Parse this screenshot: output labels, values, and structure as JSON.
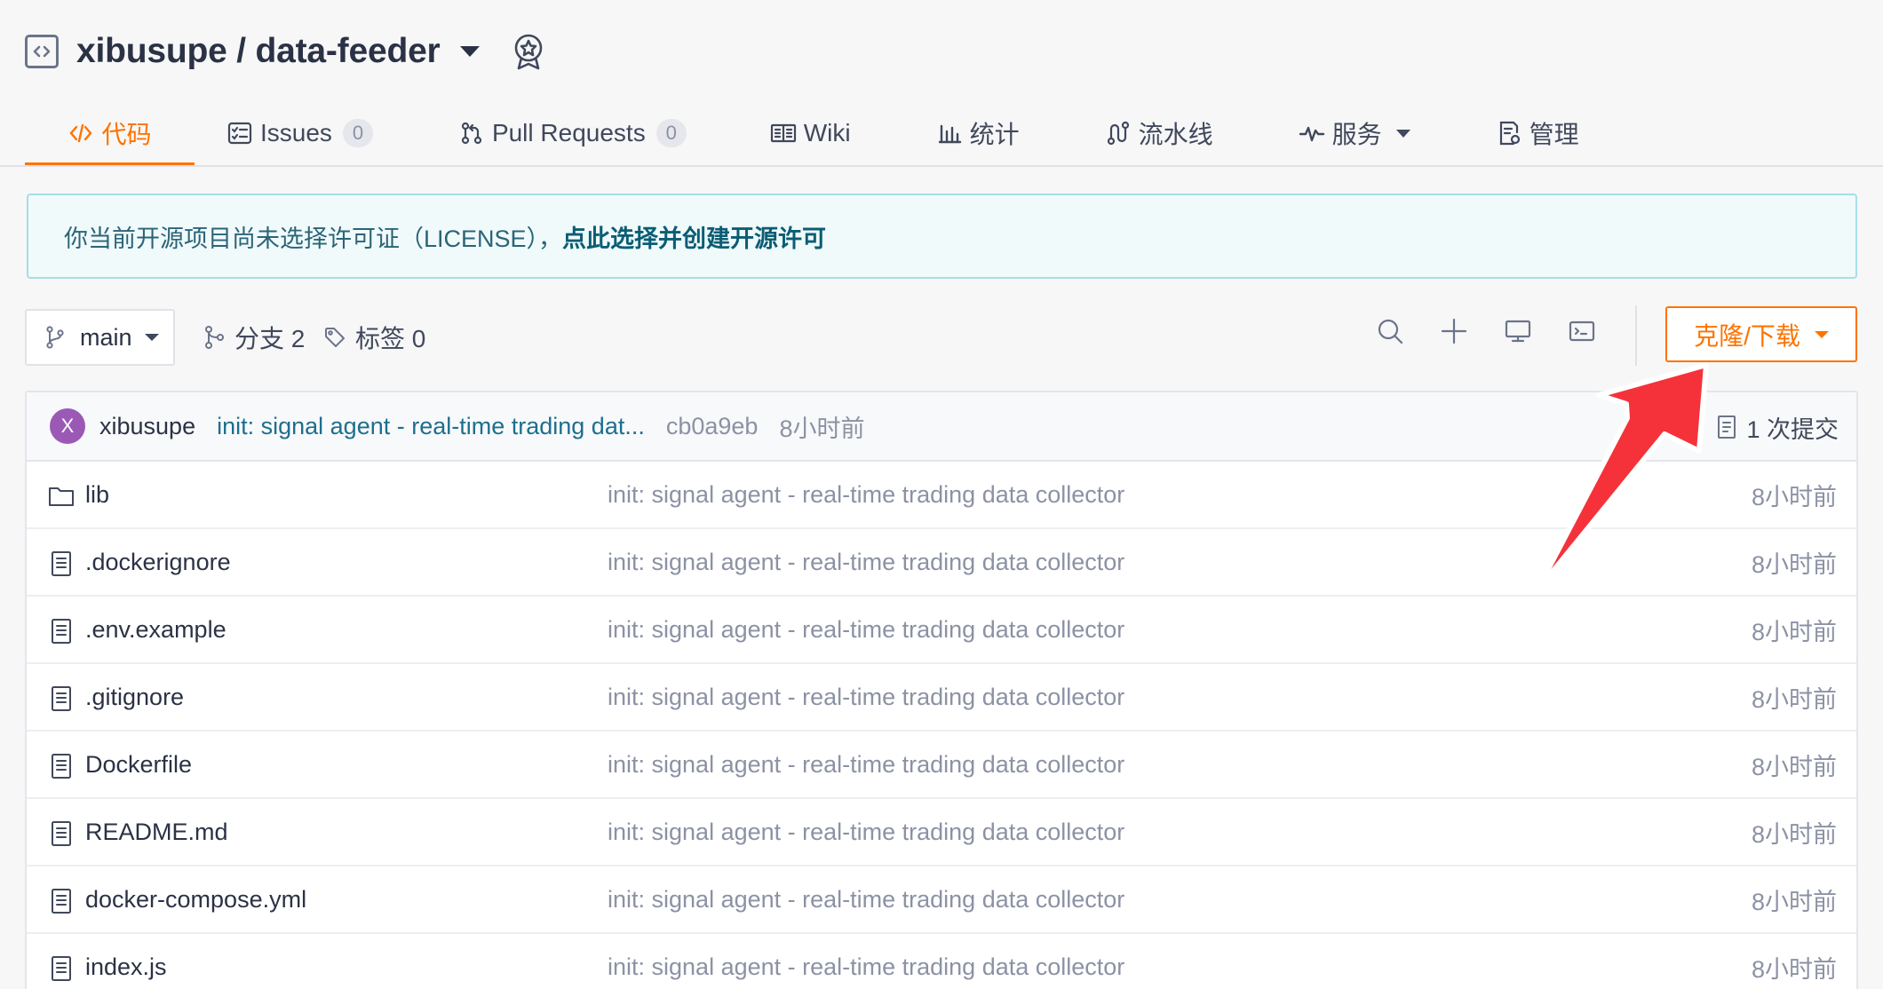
{
  "repo": {
    "title": "xibusupe / data-feeder"
  },
  "tabs": [
    {
      "label": "代码",
      "count": null
    },
    {
      "label": "Issues",
      "count": "0"
    },
    {
      "label": "Pull Requests",
      "count": "0"
    },
    {
      "label": "Wiki",
      "count": null
    },
    {
      "label": "统计",
      "count": null
    },
    {
      "label": "流水线",
      "count": null
    },
    {
      "label": "服务",
      "count": null
    },
    {
      "label": "管理",
      "count": null
    }
  ],
  "notice": {
    "text": "你当前开源项目尚未选择许可证（LICENSE），",
    "link": "点此选择并创建开源许可"
  },
  "toolbar": {
    "branch": "main",
    "branches": "分支 2",
    "tags": "标签 0",
    "clone": "克隆/下载"
  },
  "commit": {
    "avatar": "X",
    "author": "xibusupe",
    "message": "init: signal agent - real-time trading dat...",
    "sha": "cb0a9eb",
    "time": "8小时前",
    "count": "1 次提交"
  },
  "files": [
    {
      "name": "lib",
      "type": "folder",
      "message": "init: signal agent - real-time trading data collector",
      "time": "8小时前"
    },
    {
      "name": ".dockerignore",
      "type": "file",
      "message": "init: signal agent - real-time trading data collector",
      "time": "8小时前"
    },
    {
      "name": ".env.example",
      "type": "file",
      "message": "init: signal agent - real-time trading data collector",
      "time": "8小时前"
    },
    {
      "name": ".gitignore",
      "type": "file",
      "message": "init: signal agent - real-time trading data collector",
      "time": "8小时前"
    },
    {
      "name": "Dockerfile",
      "type": "file",
      "message": "init: signal agent - real-time trading data collector",
      "time": "8小时前"
    },
    {
      "name": "README.md",
      "type": "file",
      "message": "init: signal agent - real-time trading data collector",
      "time": "8小时前"
    },
    {
      "name": "docker-compose.yml",
      "type": "file",
      "message": "init: signal agent - real-time trading data collector",
      "time": "8小时前"
    },
    {
      "name": "index.js",
      "type": "file",
      "message": "init: signal agent - real-time trading data collector",
      "time": "8小时前"
    }
  ],
  "colors": {
    "accent": "#fe7300",
    "link": "#0b5d74",
    "annotation": "#f5323a"
  }
}
